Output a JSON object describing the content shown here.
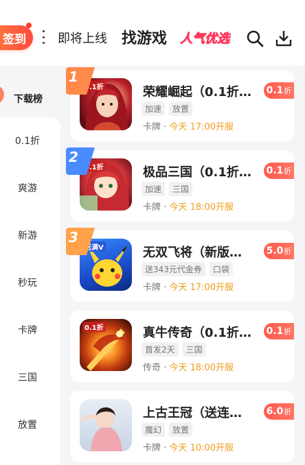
{
  "header": {
    "signin_label": "签到",
    "tabs": {
      "upcoming": "即将上线",
      "find_games": "找游戏",
      "popular": "人气优选"
    }
  },
  "sidebar": {
    "active": "下载榜",
    "items": [
      "0.1折",
      "爽游",
      "新游",
      "秒玩",
      "卡牌",
      "三国",
      "放置"
    ]
  },
  "games": [
    {
      "rank": "1",
      "title": "荣耀崛起（0.1折…",
      "tags": [
        "加速",
        "放置"
      ],
      "category": "卡牌",
      "separator": "·",
      "time": "今天 17:00开服",
      "discount_value": "0.1",
      "discount_unit": "折",
      "thumb_badge": "0.1折"
    },
    {
      "rank": "2",
      "title": "极品三国（0.1折…",
      "tags": [
        "加速",
        "三国"
      ],
      "category": "卡牌",
      "separator": "·",
      "time": "今天 18:00开服",
      "discount_value": "0.1",
      "discount_unit": "折",
      "thumb_badge": "0.1折"
    },
    {
      "rank": "3",
      "title": "无双飞将（新版…",
      "tags": [
        "送343元代金券",
        "口袋"
      ],
      "category": "卡牌",
      "separator": "·",
      "time": "今天 17:00开服",
      "discount_value": "5.0",
      "discount_unit": "折",
      "thumb_badge": "送满V"
    },
    {
      "rank": "",
      "title": "真牛传奇（0.1折…",
      "tags": [
        "首发2天",
        "三国"
      ],
      "category": "传奇",
      "separator": "·",
      "time": "今天 18:00开服",
      "discount_value": "0.1",
      "discount_unit": "折",
      "thumb_badge": "0.1折"
    },
    {
      "rank": "",
      "title": "上古王冠（送连…",
      "tags": [
        "魔幻",
        "放置"
      ],
      "category": "卡牌",
      "separator": "·",
      "time": "今天 10:00开服",
      "discount_value": "6.0",
      "discount_unit": "折",
      "thumb_badge": ""
    }
  ],
  "colors": {
    "accent": "#ff5a52",
    "time": "#f29c1f",
    "rank1": "#ff8a4a",
    "rank2": "#4a8cff",
    "rank3": "#ffa24a"
  }
}
